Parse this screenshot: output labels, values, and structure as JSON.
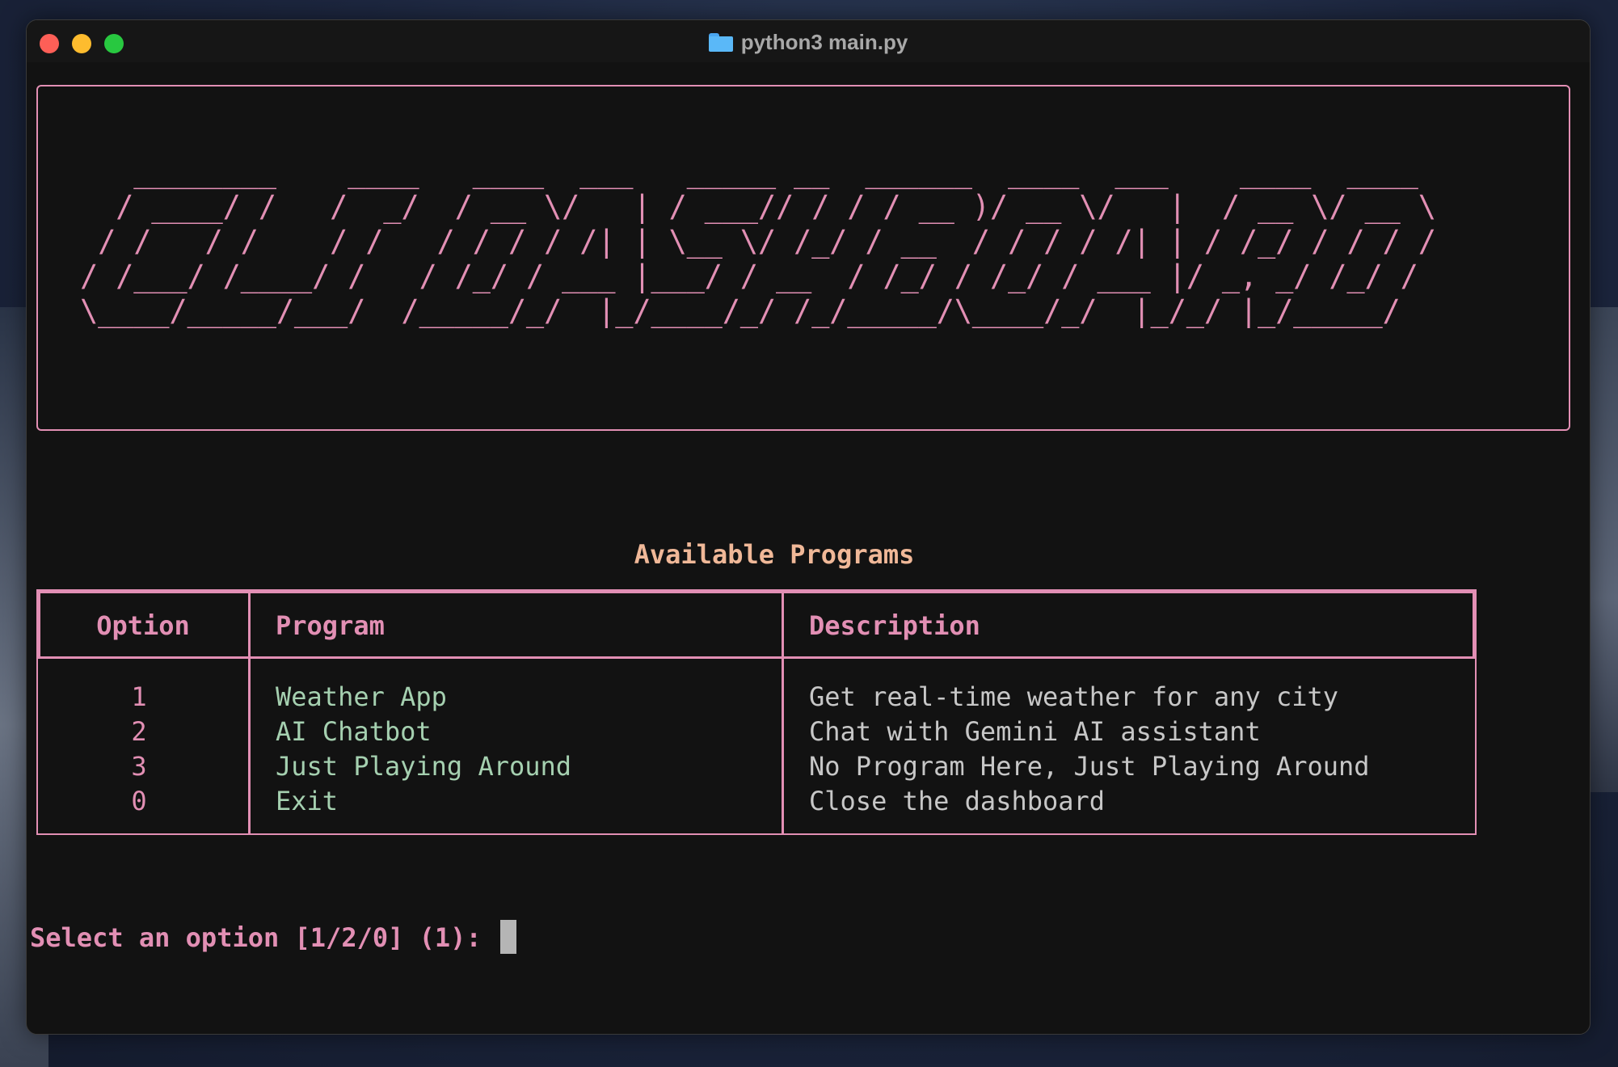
{
  "window": {
    "title": "python3 main.py",
    "folder_icon": "folder-icon"
  },
  "banner": {
    "color": "#e28fb4",
    "ascii": "   ________    ____   ____  ___   _____ __  ______  ____  ___    ____  ____\n  / ____/ /   /  _/  / __ \\/   | / ___// / / / __ )/ __ \\/   |  / __ \\/ __ \\\n / /   / /    / /   / / / / /| | \\__ \\/ /_/ / __  / / / / /| | / /_/ / / / /\n/ /___/ /____/ /   / /_/ / ___ |___/ / __  / /_/ / /_/ / ___ |/ _, _/ /_/ /\n\\____/_____/___/  /_____/_/  |_/____/_/ /_/_____/\\____/_/  |_/_/ |_/_____/"
  },
  "table": {
    "title": "Available Programs",
    "columns": [
      "Option",
      "Program",
      "Description"
    ],
    "rows": [
      {
        "option": "1",
        "program": "Weather App",
        "description": "Get real-time weather for any city"
      },
      {
        "option": "2",
        "program": "AI Chatbot",
        "description": "Chat with Gemini AI assistant"
      },
      {
        "option": "3",
        "program": "Just Playing Around",
        "description": "No Program Here, Just Playing Around"
      },
      {
        "option": "0",
        "program": "Exit",
        "description": "Close the dashboard"
      }
    ]
  },
  "prompt": {
    "text": "Select an option [1/2/0] (1): "
  },
  "colors": {
    "accent": "#e28fb4",
    "title": "#f0b898",
    "program": "#a5d0b0",
    "description": "#c7c7c7"
  }
}
